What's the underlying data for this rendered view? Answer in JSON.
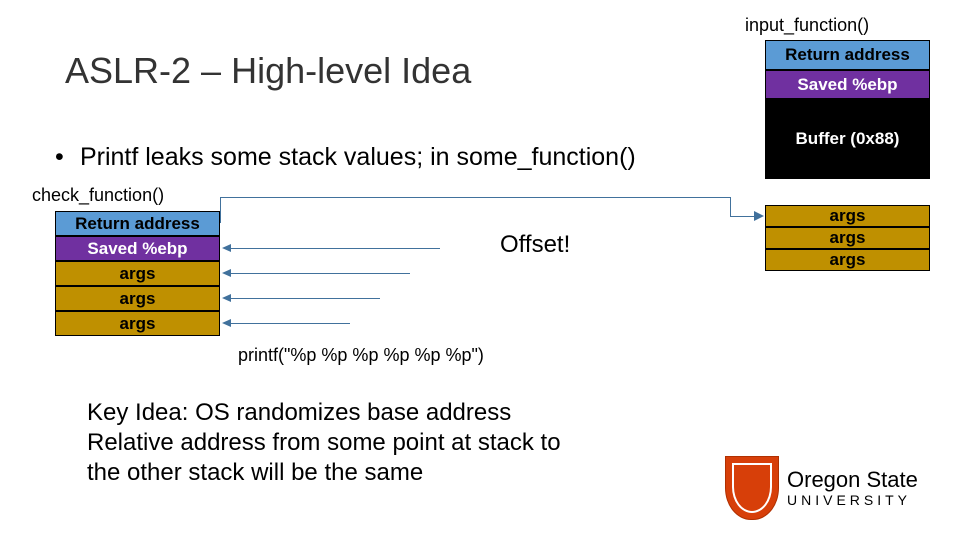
{
  "title": "ASLR-2 – High-level Idea",
  "bullet": "Printf leaks some stack values; in some_function()",
  "labels": {
    "check_function": "check_function()",
    "input_function": "input_function()",
    "offset": "Offset!",
    "printf_call": "printf(\"%p %p %p %p %p %p\")"
  },
  "right_stack": {
    "ret": "Return address",
    "ebp": "Saved %ebp",
    "buffer": "Buffer (0x88)",
    "arg1": "args",
    "arg2": "args",
    "arg3": "args"
  },
  "left_stack": {
    "ret": "Return address",
    "ebp": "Saved %ebp",
    "arg1": "args",
    "arg2": "args",
    "arg3": "args"
  },
  "key_idea": {
    "line1": "Key Idea: OS randomizes base address",
    "line2": "Relative address from some point at stack to",
    "line3": "the other stack will be the same"
  },
  "logo": {
    "line1": "Oregon State",
    "line2": "UNIVERSITY"
  }
}
